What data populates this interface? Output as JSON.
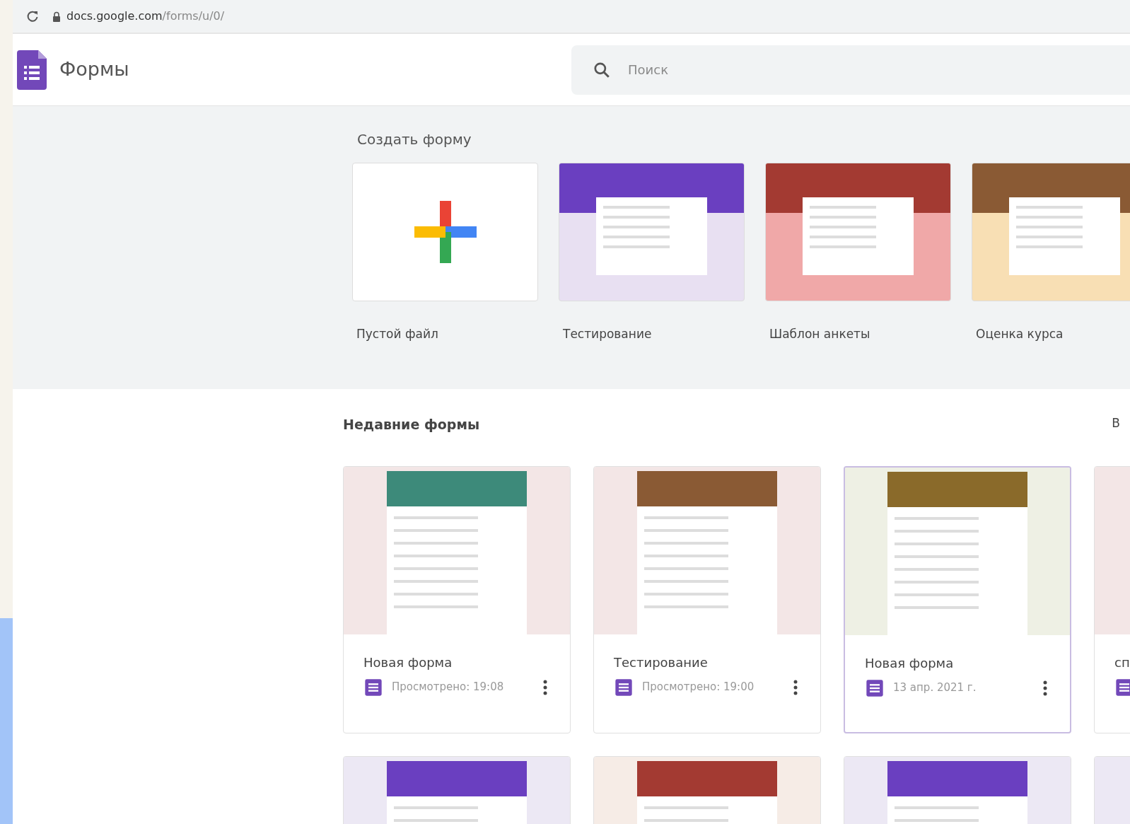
{
  "browser": {
    "url_host": "docs.google.com",
    "url_path": "/forms/u/0/"
  },
  "app": {
    "title": "Формы",
    "search": {
      "placeholder": "Поиск"
    }
  },
  "create": {
    "heading": "Создать форму",
    "templates": [
      {
        "kind": "blank",
        "label": "Пустой файл"
      },
      {
        "kind": "photo",
        "label": "Тестирование"
      },
      {
        "kind": "solid",
        "label": "Шаблон анкеты"
      },
      {
        "kind": "photo",
        "label": "Оценка курса"
      }
    ]
  },
  "recent": {
    "heading": "Недавние формы",
    "owner_filter": "В",
    "forms": [
      {
        "title": "Новая форма",
        "date": "Просмотрено: 19:08",
        "selected": false
      },
      {
        "title": "Тестирование",
        "date": "Просмотрено: 19:00",
        "selected": false
      },
      {
        "title": "Новая форма",
        "date": "13 апр. 2021 г.",
        "selected": true
      },
      {
        "title": "сп",
        "selected": false
      },
      {
        "selected": false
      },
      {
        "selected": false
      },
      {
        "selected": false
      },
      {
        "selected": false
      }
    ]
  }
}
